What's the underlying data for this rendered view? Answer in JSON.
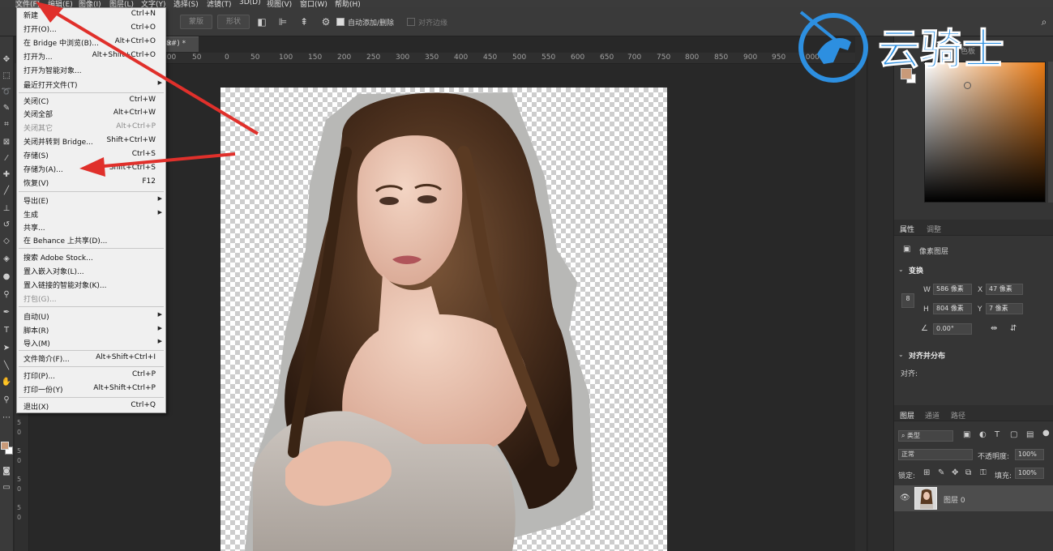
{
  "menubar": {
    "items": [
      "文件(F)",
      "编辑(E)",
      "图像(I)",
      "图层(L)",
      "文字(Y)",
      "选择(S)",
      "滤镜(T)",
      "3D(D)",
      "视图(V)",
      "窗口(W)",
      "帮助(H)"
    ]
  },
  "options": {
    "btn_mask": "蒙版",
    "btn_shape": "形状",
    "auto_add_delete": "自动添加/删除",
    "align_edges": "对齐边缘"
  },
  "document": {
    "tab_title": "8#) *",
    "close_glyph": "×"
  },
  "ruler": {
    "h_ticks": [
      "100",
      "50",
      "0",
      "50",
      "100",
      "150",
      "200",
      "250",
      "300",
      "350",
      "400",
      "450",
      "500",
      "550",
      "600",
      "650",
      "700",
      "750",
      "800",
      "850",
      "900",
      "950",
      "1000"
    ],
    "v_ticks": [
      "5",
      "0",
      "5",
      "0",
      "5",
      "0",
      "5",
      "0",
      "5",
      "0",
      "5",
      "0",
      "5",
      "0",
      "5",
      "0",
      "5",
      "0",
      "5",
      "0"
    ]
  },
  "file_menu": {
    "items": [
      {
        "label": "新建",
        "shortcut": "Ctrl+N",
        "disabled": false,
        "submenu": false
      },
      {
        "label": "打开(O)...",
        "shortcut": "Ctrl+O",
        "disabled": false,
        "submenu": false
      },
      {
        "label": "在 Bridge 中浏览(B)...",
        "shortcut": "Alt+Ctrl+O",
        "disabled": false,
        "submenu": false
      },
      {
        "label": "打开为...",
        "shortcut": "Alt+Shift+Ctrl+O",
        "disabled": false,
        "submenu": false
      },
      {
        "label": "打开为智能对象...",
        "shortcut": "",
        "disabled": false,
        "submenu": false
      },
      {
        "label": "最近打开文件(T)",
        "shortcut": "",
        "disabled": false,
        "submenu": true
      },
      {
        "label": "关闭(C)",
        "shortcut": "Ctrl+W",
        "disabled": false,
        "submenu": false
      },
      {
        "label": "关闭全部",
        "shortcut": "Alt+Ctrl+W",
        "disabled": false,
        "submenu": false
      },
      {
        "label": "关闭其它",
        "shortcut": "Alt+Ctrl+P",
        "disabled": true,
        "submenu": false
      },
      {
        "label": "关闭并转到 Bridge...",
        "shortcut": "Shift+Ctrl+W",
        "disabled": false,
        "submenu": false
      },
      {
        "label": "存储(S)",
        "shortcut": "Ctrl+S",
        "disabled": false,
        "submenu": false
      },
      {
        "label": "存储为(A)...",
        "shortcut": "Shift+Ctrl+S",
        "disabled": false,
        "submenu": false
      },
      {
        "label": "恢复(V)",
        "shortcut": "F12",
        "disabled": false,
        "submenu": false
      },
      {
        "label": "导出(E)",
        "shortcut": "",
        "disabled": false,
        "submenu": true
      },
      {
        "label": "生成",
        "shortcut": "",
        "disabled": false,
        "submenu": true
      },
      {
        "label": "共享...",
        "shortcut": "",
        "disabled": false,
        "submenu": false
      },
      {
        "label": "在 Behance 上共享(D)...",
        "shortcut": "",
        "disabled": false,
        "submenu": false
      },
      {
        "label": "搜索 Adobe Stock...",
        "shortcut": "",
        "disabled": false,
        "submenu": false
      },
      {
        "label": "置入嵌入对象(L)...",
        "shortcut": "",
        "disabled": false,
        "submenu": false
      },
      {
        "label": "置入链接的智能对象(K)...",
        "shortcut": "",
        "disabled": false,
        "submenu": false
      },
      {
        "label": "打包(G)...",
        "shortcut": "",
        "disabled": true,
        "submenu": false
      },
      {
        "label": "自动(U)",
        "shortcut": "",
        "disabled": false,
        "submenu": true
      },
      {
        "label": "脚本(R)",
        "shortcut": "",
        "disabled": false,
        "submenu": true
      },
      {
        "label": "导入(M)",
        "shortcut": "",
        "disabled": false,
        "submenu": true
      },
      {
        "label": "文件简介(F)...",
        "shortcut": "Alt+Shift+Ctrl+I",
        "disabled": false,
        "submenu": false
      },
      {
        "label": "打印(P)...",
        "shortcut": "Ctrl+P",
        "disabled": false,
        "submenu": false
      },
      {
        "label": "打印一份(Y)",
        "shortcut": "Alt+Shift+Ctrl+P",
        "disabled": false,
        "submenu": false
      },
      {
        "label": "退出(X)",
        "shortcut": "Ctrl+Q",
        "disabled": false,
        "submenu": false
      }
    ]
  },
  "color_panel": {
    "tab": "色板",
    "foreground": "#c89a79",
    "background": "#ffffff"
  },
  "properties": {
    "tab_properties": "属性",
    "tab_adjust": "调整",
    "layer_kind": "像素图层",
    "transform_title": "变换",
    "w_label": "W",
    "w_value": "586 像素",
    "x_label": "X",
    "x_value": "47 像素",
    "h_label": "H",
    "h_value": "804 像素",
    "y_label": "Y",
    "y_value": "7 像素",
    "angle_value": "0.00°",
    "align_title": "对齐并分布",
    "align_label": "对齐:"
  },
  "layers": {
    "tab_layers": "图层",
    "tab_channels": "通道",
    "tab_paths": "路径",
    "filter_kind": "类型",
    "blend_mode": "正常",
    "opacity_label": "不透明度:",
    "opacity_value": "100%",
    "lock_label": "锁定:",
    "fill_label": "填充:",
    "fill_value": "100%",
    "layer_name": "图层 0"
  },
  "watermark": {
    "brand": "云骑士"
  },
  "colors": {
    "accent_blue": "#2d8fe0",
    "annotation_red": "#e0302b"
  }
}
